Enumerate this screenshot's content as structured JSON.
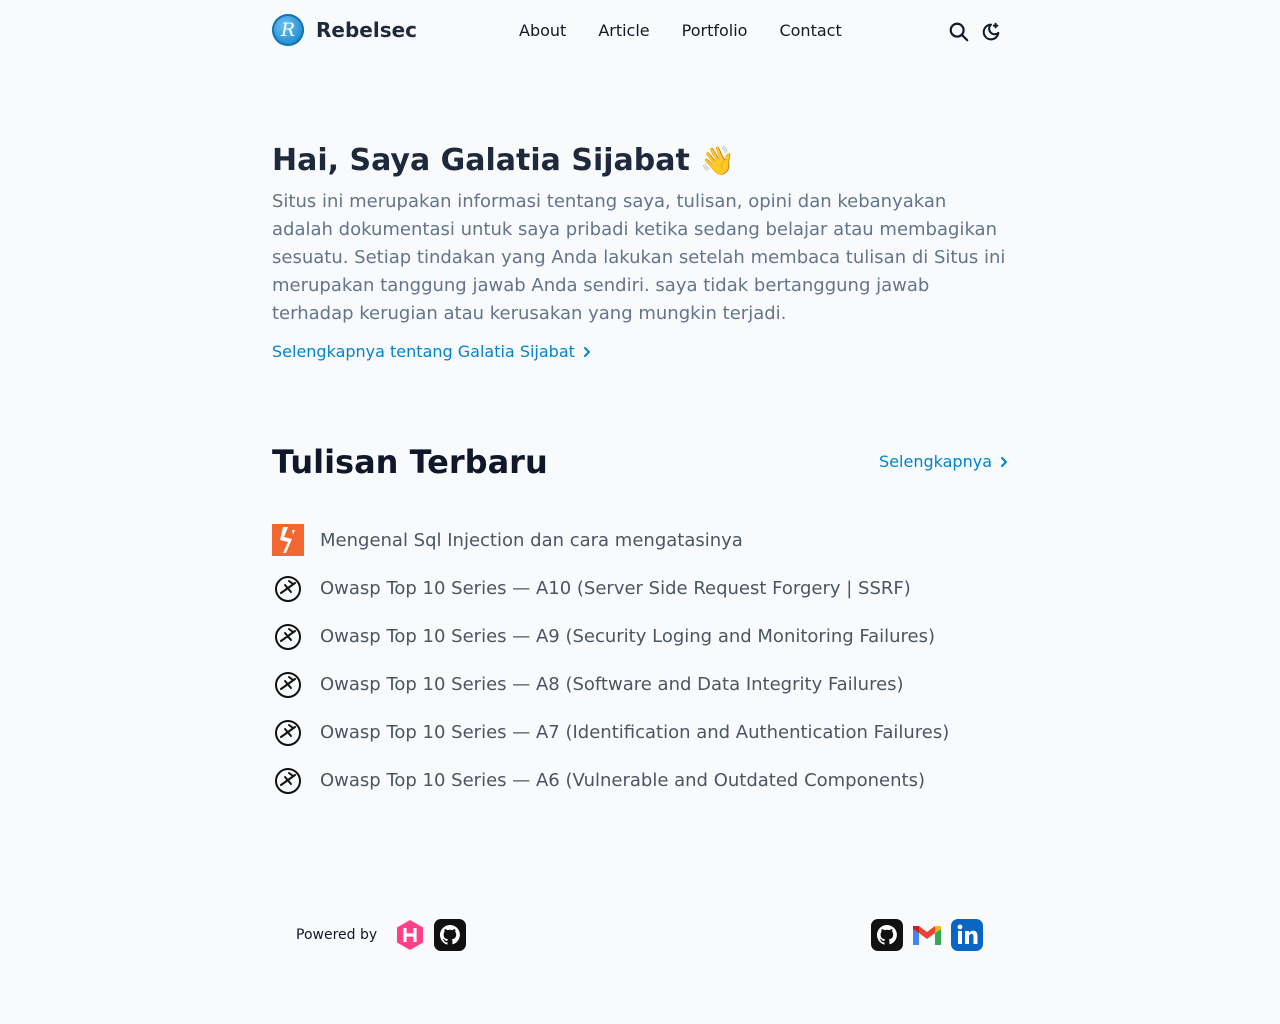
{
  "brand": {
    "name": "Rebelsec",
    "logo_letter": "R",
    "logo_icon": "brand-logo-icon"
  },
  "nav": [
    {
      "label": "About"
    },
    {
      "label": "Article"
    },
    {
      "label": "Portfolio"
    },
    {
      "label": "Contact"
    }
  ],
  "tools": {
    "search_icon": "search-icon",
    "theme_icon": "moon-icon"
  },
  "hero": {
    "title": "Hai, Saya Galatia Sijabat",
    "emoji": "👋",
    "description": "Situs ini merupakan informasi tentang saya, tulisan, opini dan kebanyakan adalah dokumentasi untuk saya pribadi ketika sedang belajar atau membagikan sesuatu. Setiap tindakan yang Anda lakukan setelah membaca tulisan di Situs ini merupakan tanggung jawab Anda sendiri. saya tidak bertanggung jawab terhadap kerugian atau kerusakan yang mungkin terjadi.",
    "link": "Selengkapnya tentang Galatia Sijabat"
  },
  "latest": {
    "heading": "Tulisan Terbaru",
    "more": "Selengkapnya",
    "posts": [
      {
        "title": "Mengenal Sql Injection dan cara mengatasinya",
        "icon": "hackthebox-style-icon"
      },
      {
        "title": "Owasp Top 10 Series — A10 (Server Side Request Forgery | SSRF)",
        "icon": "owasp-icon"
      },
      {
        "title": "Owasp Top 10 Series — A9 (Security Loging and Monitoring Failures)",
        "icon": "owasp-icon"
      },
      {
        "title": "Owasp Top 10 Series — A8 (Software and Data Integrity Failures)",
        "icon": "owasp-icon"
      },
      {
        "title": "Owasp Top 10 Series — A7 (Identification and Authentication Failures)",
        "icon": "owasp-icon"
      },
      {
        "title": "Owasp Top 10 Series — A6 (Vulnerable and Outdated Components)",
        "icon": "owasp-icon"
      }
    ]
  },
  "footer": {
    "powered_by": "Powered by",
    "powered_icons": [
      "hugo-icon",
      "github-icon"
    ],
    "social_icons": [
      "github-icon",
      "gmail-icon",
      "linkedin-icon"
    ]
  },
  "colors": {
    "background": "#f8fafc",
    "accent": "#0284c7",
    "text": "#1e293b",
    "muted": "#64748b",
    "hugo": "#ff4088",
    "linkedin": "#0a66c2"
  }
}
